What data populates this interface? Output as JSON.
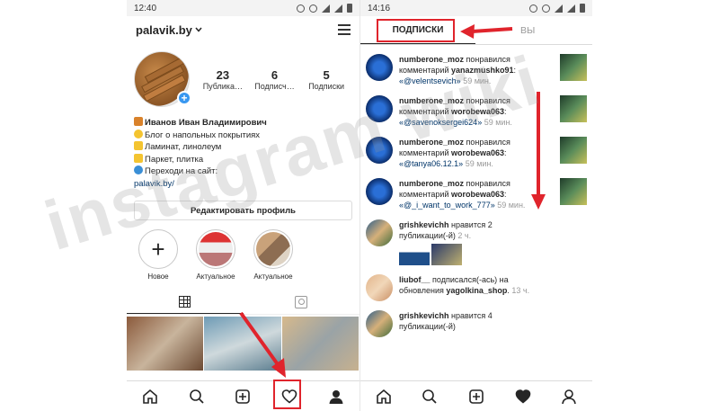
{
  "left": {
    "status": {
      "time": "12:40"
    },
    "username": "palavik.by",
    "stats": [
      {
        "value": "23",
        "label": "Публика…"
      },
      {
        "value": "6",
        "label": "Подписч…"
      },
      {
        "value": "5",
        "label": "Подписки"
      }
    ],
    "bio": {
      "name": "Иванов Иван Владимирович",
      "lines": [
        "Блог о напольных покрытиях",
        "Ламинат, линолеум",
        "Паркет, плитка",
        "Переходи на сайт:"
      ],
      "link": "palavik.by/"
    },
    "edit_profile_label": "Редактировать профиль",
    "highlights": [
      {
        "label": "Новое"
      },
      {
        "label": "Актуальное"
      },
      {
        "label": "Актуальное"
      }
    ]
  },
  "right": {
    "status": {
      "time": "14:16"
    },
    "tabs": {
      "following": "ПОДПИСКИ",
      "you": "ВЫ"
    },
    "feed": [
      {
        "user": "numberone_moz",
        "action": "понравился комментарий",
        "target": "yanazmushko91",
        "comment": "«@velentsevich»",
        "time": "59 мин."
      },
      {
        "user": "numberone_moz",
        "action": "понравился комментарий",
        "target": "worobewa063",
        "comment": "«@savenoksergei624»",
        "time": "59 мин."
      },
      {
        "user": "numberone_moz",
        "action": "понравился комментарий",
        "target": "worobewa063",
        "comment": "«@tanya06.12.1»",
        "time": "59 мин."
      },
      {
        "user": "numberone_moz",
        "action": "понравился комментарий",
        "target": "worobewa063",
        "comment": "«@_i_want_to_work_777»",
        "time": "59 мин."
      },
      {
        "user": "grishkevichh",
        "action": "нравится 2 публикации(-й)",
        "time": "2 ч."
      },
      {
        "user": "liubof__",
        "action": "подписался(-ась) на обновления",
        "target": "yagolkina_shop",
        "time": "13 ч."
      },
      {
        "user": "grishkevichh",
        "action": "нравится 4 публикации(-й)",
        "time": ""
      }
    ]
  },
  "watermark": "instagram wiki",
  "colors": {
    "annotation_red": "#e0242c",
    "link": "#003569",
    "accent": "#3897f0"
  }
}
